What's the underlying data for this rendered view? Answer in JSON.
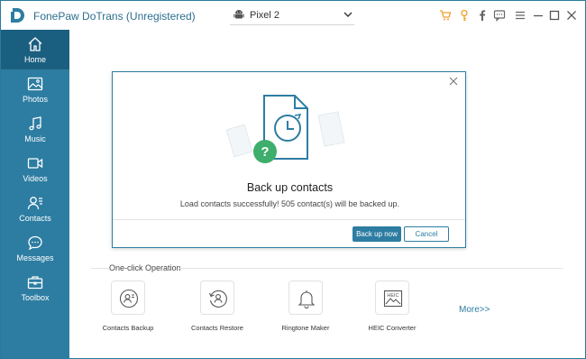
{
  "app": {
    "title": "FonePaw DoTrans (Unregistered)",
    "device": "Pixel 2"
  },
  "titlebar_icons": [
    "cart-icon",
    "key-icon",
    "facebook-icon",
    "feedback-icon",
    "menu-icon",
    "minimize-icon",
    "maximize-icon",
    "close-icon"
  ],
  "sidebar": {
    "items": [
      {
        "label": "Home",
        "icon": "home-icon",
        "active": true
      },
      {
        "label": "Photos",
        "icon": "photos-icon",
        "active": false
      },
      {
        "label": "Music",
        "icon": "music-icon",
        "active": false
      },
      {
        "label": "Videos",
        "icon": "videos-icon",
        "active": false
      },
      {
        "label": "Contacts",
        "icon": "contacts-icon",
        "active": false
      },
      {
        "label": "Messages",
        "icon": "messages-icon",
        "active": false
      },
      {
        "label": "Toolbox",
        "icon": "toolbox-icon",
        "active": false
      }
    ]
  },
  "dialog": {
    "title": "Back up contacts",
    "message": "Load contacts successfully! 505 contact(s) will be backed up.",
    "primary_button": "Back up now",
    "secondary_button": "Cancel"
  },
  "one_click": {
    "title": "One-click Operation",
    "operations": [
      {
        "label": "Contacts Backup",
        "icon": "contacts-backup-icon"
      },
      {
        "label": "Contacts Restore",
        "icon": "contacts-restore-icon"
      },
      {
        "label": "Ringtone Maker",
        "icon": "ringtone-maker-icon"
      },
      {
        "label": "HEIC Converter",
        "icon": "heic-converter-icon"
      }
    ],
    "more_label": "More>>"
  },
  "colors": {
    "accent": "#2d7da2",
    "sidebar_active": "#1b5f80",
    "success_green": "#3dae6b",
    "brand_orange": "#f0a030"
  }
}
